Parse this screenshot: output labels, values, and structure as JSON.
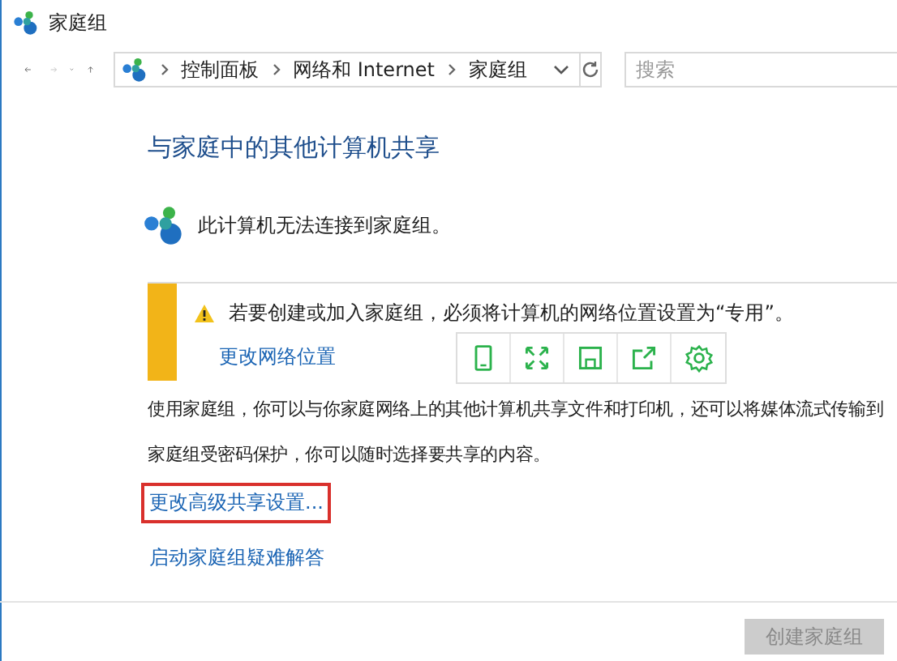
{
  "window": {
    "title": "家庭组"
  },
  "address_bar": {
    "breadcrumbs": [
      "控制面板",
      "网络和 Internet",
      "家庭组"
    ]
  },
  "search": {
    "placeholder": "搜索"
  },
  "heading": "与家庭中的其他计算机共享",
  "status": "此计算机无法连接到家庭组。",
  "warning": {
    "message": "若要创建或加入家庭组，必须将计算机的网络位置设置为“专用”。",
    "link": "更改网络位置"
  },
  "paragraphs": [
    "使用家庭组，你可以与你家庭网络上的其他计算机共享文件和打印机，还可以将媒体流式传输到",
    "家庭组受密码保护，你可以随时选择要共享的内容。"
  ],
  "links": [
    {
      "label": "更改高级共享设置...",
      "highlighted": true
    },
    {
      "label": "启动家庭组疑难解答",
      "highlighted": false
    }
  ],
  "floating_toolbar": {
    "tools": [
      {
        "kind": "tablet"
      },
      {
        "kind": "expand"
      },
      {
        "kind": "save"
      },
      {
        "kind": "share"
      },
      {
        "kind": "settings"
      }
    ]
  },
  "buttons": [
    {
      "label": "创建家庭组",
      "disabled": true
    }
  ]
}
